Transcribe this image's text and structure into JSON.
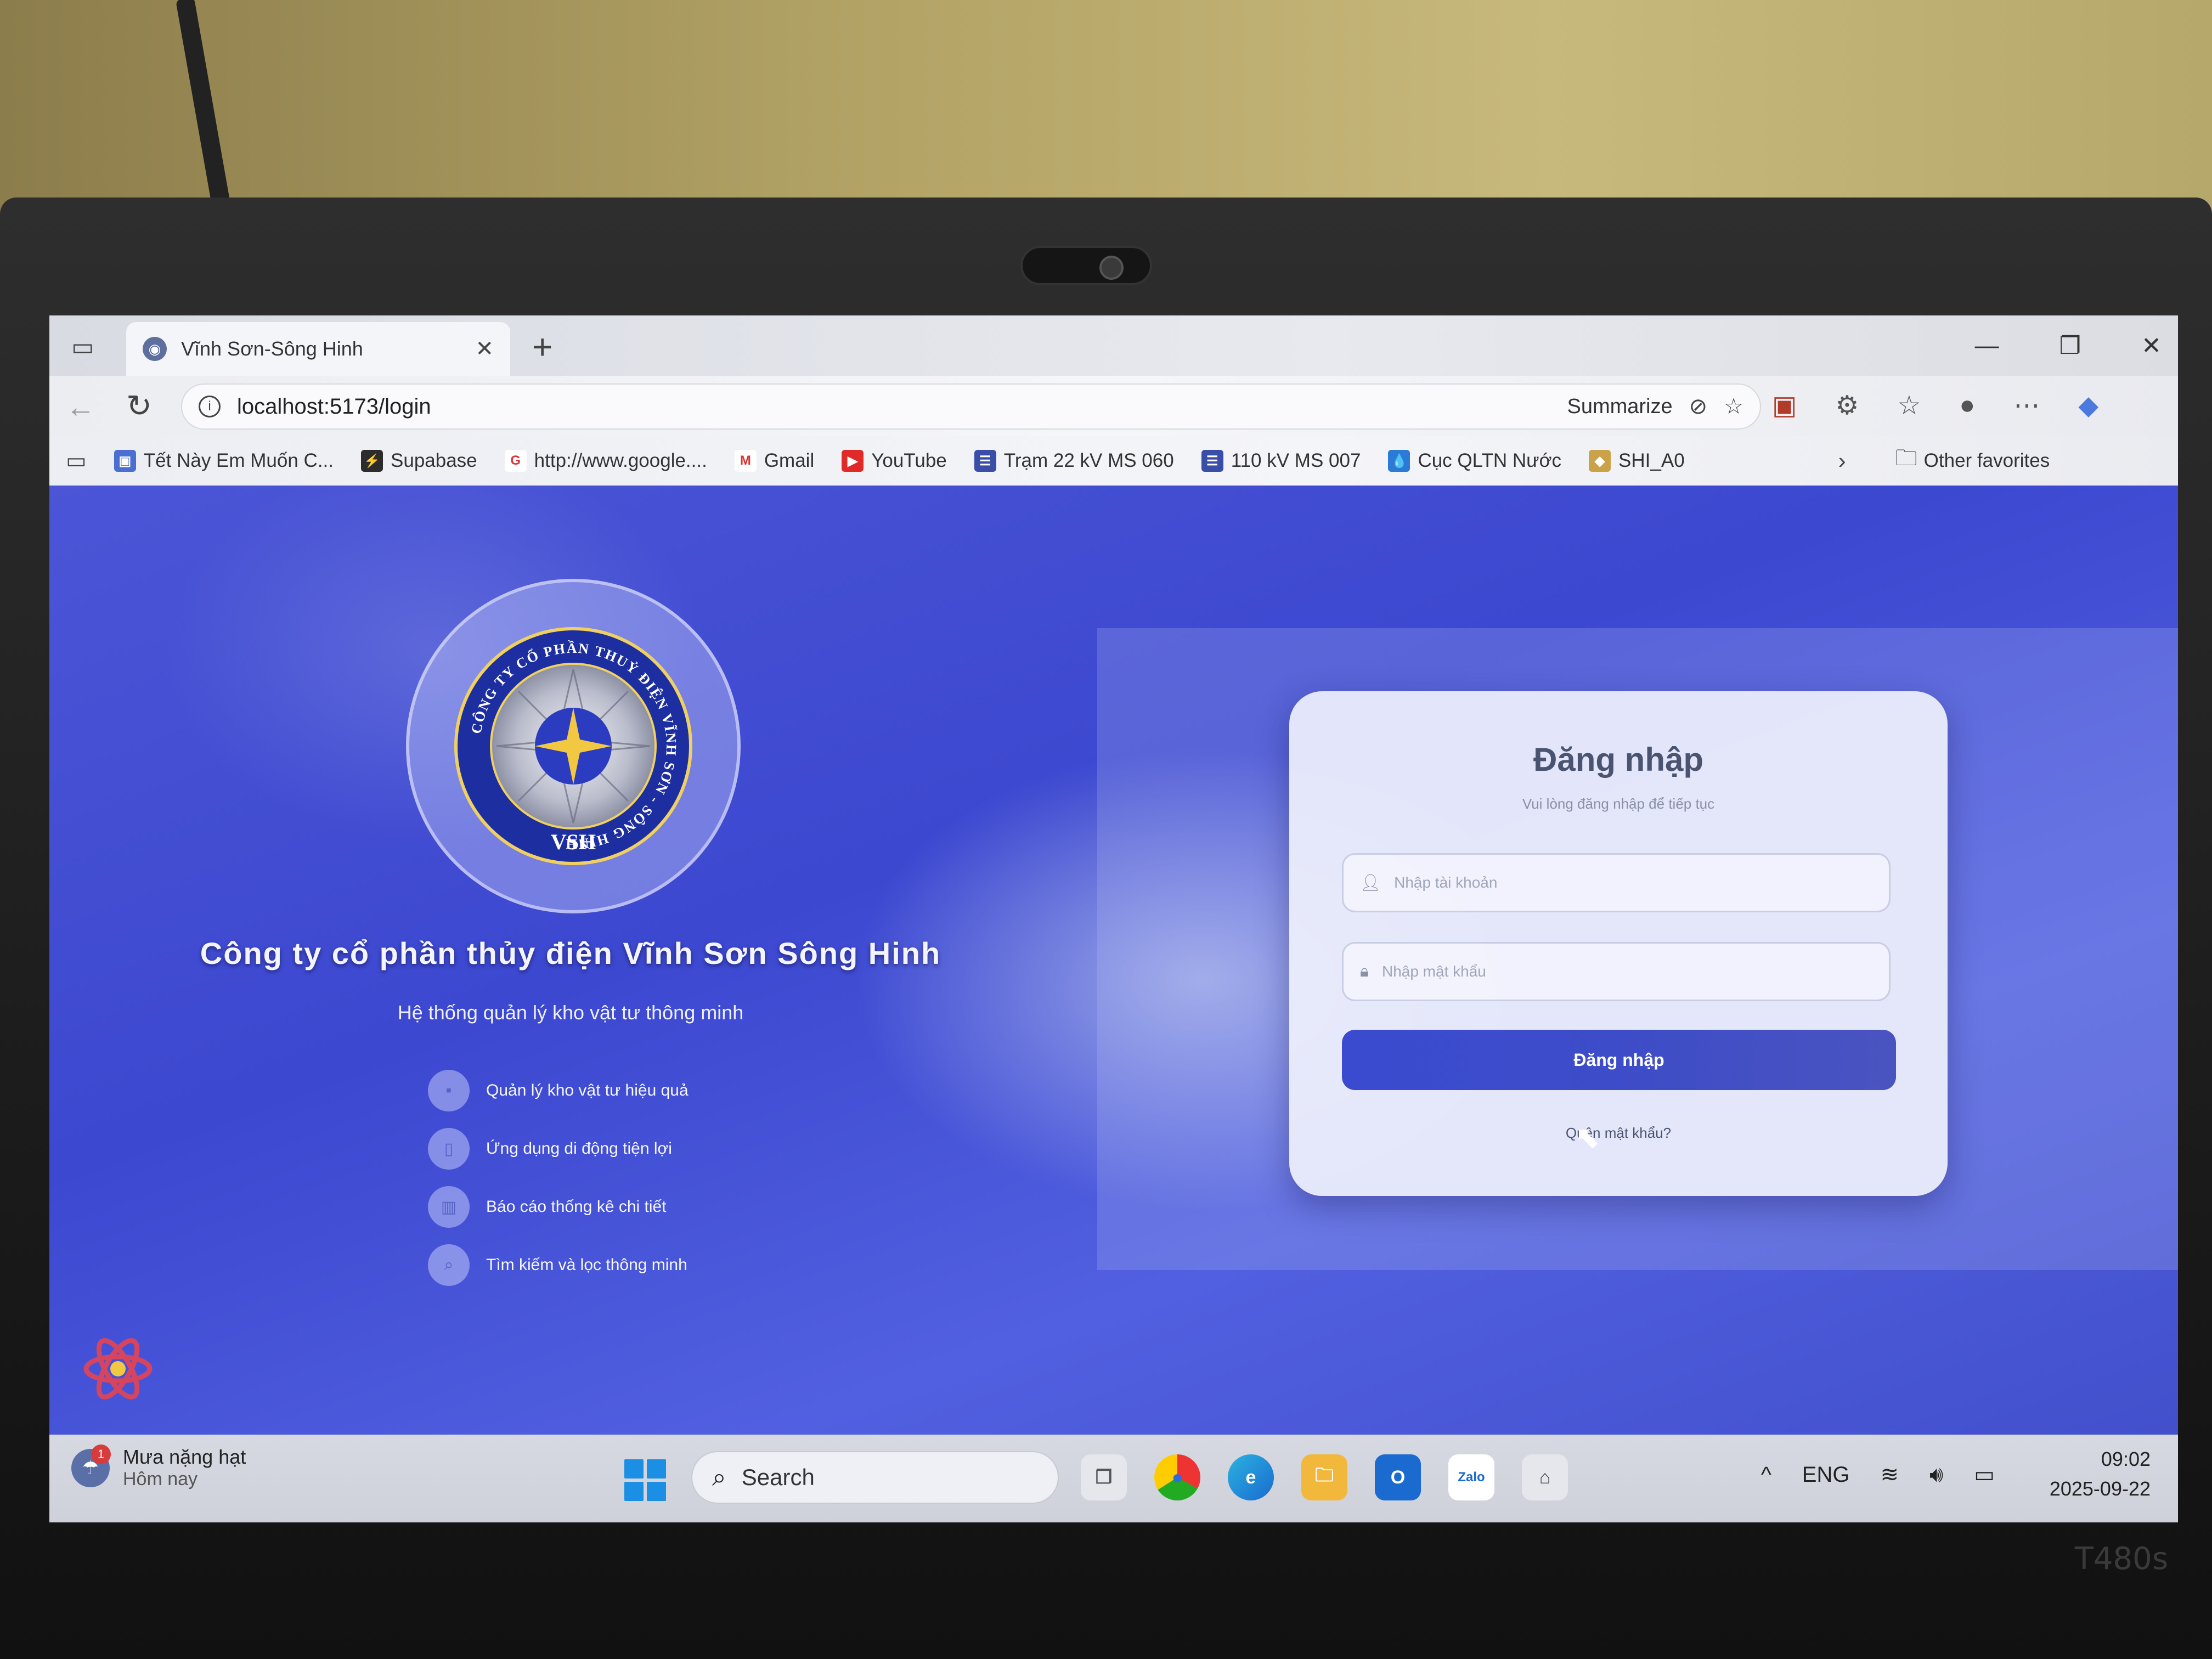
{
  "browser": {
    "tab": {
      "title": "Vĩnh Sơn-Sông Hinh",
      "favicon": "globe-icon"
    },
    "url": "localhost:5173/login",
    "summarize_label": "Summarize",
    "bookmarks": [
      {
        "label": "Tết Này Em Muốn C...",
        "icon": "bookmark-icon",
        "color": "#4a6fd0",
        "glyph": "▣"
      },
      {
        "label": "Supabase",
        "icon": "supabase-icon",
        "color": "#2c2c2c",
        "glyph": "⚡"
      },
      {
        "label": "http://www.google....",
        "icon": "google-icon",
        "color": "#ffffff",
        "glyph": "G"
      },
      {
        "label": "Gmail",
        "icon": "gmail-icon",
        "color": "#ffffff",
        "glyph": "M"
      },
      {
        "label": "YouTube",
        "icon": "youtube-icon",
        "color": "#e02a2a",
        "glyph": "▶"
      },
      {
        "label": "Trạm 22 kV MS 060",
        "icon": "sheet-icon",
        "color": "#3a4ea8",
        "glyph": "☰"
      },
      {
        "label": "110 kV MS 007",
        "icon": "sheet-icon",
        "color": "#3a4ea8",
        "glyph": "☰"
      },
      {
        "label": "Cục QLTN Nước",
        "icon": "water-drop-icon",
        "color": "#2a7ad6",
        "glyph": "💧"
      },
      {
        "label": "SHI_A0",
        "icon": "app-icon",
        "color": "#c9a24a",
        "glyph": "◆"
      }
    ],
    "other_favorites": "Other favorites"
  },
  "page": {
    "company_name": "Công ty cổ phần thủy điện Vĩnh Sơn Sông Hinh",
    "subtitle": "Hệ thống quản lý kho vật tư thông minh",
    "seal_text": "CÔNG TY CỔ PHẦN THUỶ ĐIỆN VĨNH SƠN - SÔNG HINH",
    "seal_abbr": "VSH",
    "features": [
      {
        "label": "Quản lý kho vật tư hiệu quả",
        "icon": "box-icon"
      },
      {
        "label": "Ứng dụng di động tiện lợi",
        "icon": "mobile-icon"
      },
      {
        "label": "Báo cáo thống kê chi tiết",
        "icon": "chart-icon"
      },
      {
        "label": "Tìm kiếm và lọc thông minh",
        "icon": "search-icon"
      }
    ],
    "login": {
      "title": "Đăng nhập",
      "subtitle": "Vui lòng đăng nhập để tiếp tục",
      "username_placeholder": "Nhập tài khoản",
      "password_placeholder": "Nhập mật khẩu",
      "submit_label": "Đăng nhập",
      "forgot_label": "Quên mật khẩu?"
    }
  },
  "taskbar": {
    "weather_title": "Mưa nặng hạt",
    "weather_sub": "Hôm nay",
    "weather_badge": "1",
    "search_label": "Search",
    "language": "ENG",
    "time": "09:02",
    "date": "2025-09-22"
  },
  "device": {
    "model": "T480s"
  },
  "colors": {
    "accent": "#3a4bd0",
    "page_bg": "#4b55d6"
  }
}
